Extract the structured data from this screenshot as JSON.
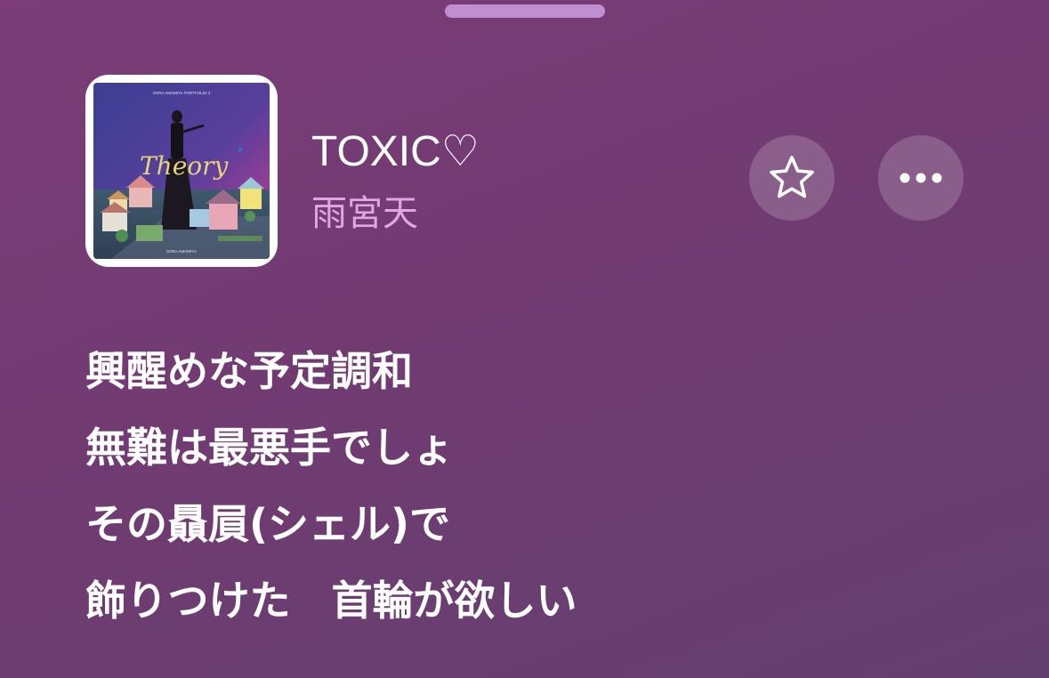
{
  "track": {
    "title": "TOXIC♡",
    "artist": "雨宮天",
    "artwork": {
      "title_text": "Theory",
      "header_text": "SORA AMAMIYA PORTFOLIO 3",
      "footer_text": "SORA AMAMIYA"
    }
  },
  "actions": {
    "favorite_icon": "star-outline-icon",
    "more_icon": "ellipsis-icon"
  },
  "lyrics": {
    "lines": [
      "興醒めな予定調和",
      "無難は最悪手でしょ",
      "その贔屓(シェル)で",
      "飾りつけた　首輪が欲しい"
    ]
  },
  "colors": {
    "background_top": "#7b3c78",
    "background_bottom": "#64406f",
    "artist_text": "#e2a6e6",
    "grabber": "#c08fcf"
  }
}
